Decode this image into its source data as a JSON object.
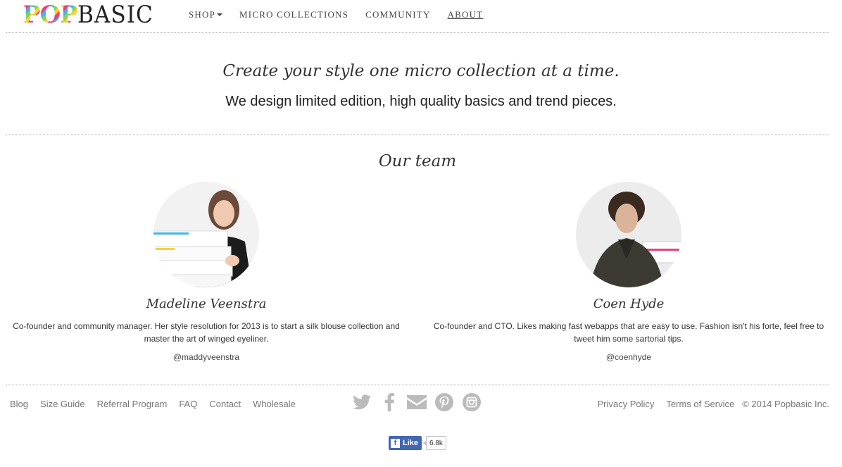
{
  "header": {
    "logo_pop": "POP",
    "logo_basic": "BASIC",
    "nav": [
      {
        "label": "SHOP",
        "dropdown": true
      },
      {
        "label": "MICRO COLLECTIONS"
      },
      {
        "label": "COMMUNITY"
      },
      {
        "label": "ABOUT",
        "active": true
      }
    ]
  },
  "hero": {
    "tagline": "Create your style one micro collection at a time.",
    "subtitle": "We design limited edition, high quality basics and trend pieces."
  },
  "team": {
    "title": "Our team",
    "members": [
      {
        "name": "Madeline Veenstra",
        "bio": "Co-founder and community manager. Her style resolution for 2013 is to start a silk blouse collection and master the art of winged eyeliner.",
        "handle": "@maddyveenstra"
      },
      {
        "name": "Coen Hyde",
        "bio": "Co-founder and CTO. Likes making fast webapps that are easy to use. Fashion isn't his forte, feel free to tweet him some sartorial tips.",
        "handle": "@coenhyde"
      }
    ]
  },
  "footer": {
    "links": [
      "Blog",
      "Size Guide",
      "Referral Program",
      "FAQ",
      "Contact",
      "Wholesale"
    ],
    "social": [
      "twitter-icon",
      "facebook-icon",
      "email-icon",
      "pinterest-icon",
      "instagram-icon"
    ],
    "right_links": [
      "Privacy Policy",
      "Terms of Service"
    ],
    "copyright": "© 2014 Popbasic Inc.",
    "fb_like_label": "Like",
    "fb_like_count": "6.8k"
  },
  "colors": {
    "text": "#333333",
    "muted": "#777777",
    "social_gray": "#bbbbbb",
    "facebook_blue": "#4267b2"
  }
}
